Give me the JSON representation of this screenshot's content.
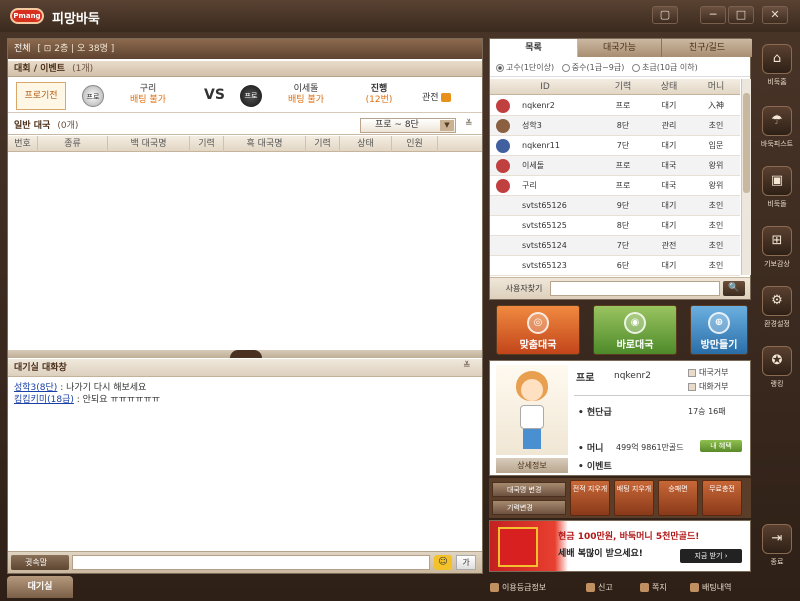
{
  "app": {
    "title": "피망바둑",
    "logo": "Pmang"
  },
  "window": {
    "buttons": [
      "▢",
      "─",
      "□",
      "✕"
    ]
  },
  "lobby": {
    "all_label": "전체",
    "all_count": "[ ⊡ 2층 | 오 38명 ]",
    "event_label": "대회 / 이벤트",
    "event_count": "(1개)",
    "pro_badge": "프로기전",
    "player1": {
      "stone": "프로",
      "name": "구리",
      "bet": "배팅 불가"
    },
    "vs": "VS",
    "player2": {
      "stone": "프로",
      "name": "이세돌",
      "bet": "배팅 불가"
    },
    "status": {
      "label": "진행",
      "move": "(12번)"
    },
    "watch": "관전",
    "general_label": "일반 대국",
    "general_count": "(0개)",
    "rank_filter": "프로 ~ 8단",
    "columns": [
      "번호",
      "종류",
      "백 대국명",
      "기력",
      "흑 대국명",
      "기력",
      "상태",
      "인원"
    ]
  },
  "chat": {
    "title": "대기실 대화창",
    "lines": [
      {
        "user": "성학3(8단)",
        "text": " : 나가기 다시 해보세요"
      },
      {
        "user": "킴킴키미(18급)",
        "text": " : 안되요 ㅠㅠㅠㅠㅠㅠ"
      }
    ],
    "whisper": "귓속말",
    "emoji": "☺",
    "font": "가"
  },
  "footer": {
    "waitroom_tab": "대기실",
    "links": [
      "이용등급정보",
      "신고",
      "쪽지",
      "배팅내역"
    ]
  },
  "userlist": {
    "tabs": [
      "목록",
      "대국가능",
      "친구/길드"
    ],
    "filters": [
      {
        "label": "고수(1단이상)",
        "on": true
      },
      {
        "label": "중수(1급~9급)",
        "on": false
      },
      {
        "label": "초급(10급 이하)",
        "on": false
      }
    ],
    "columns": [
      "ID",
      "기력",
      "상태",
      "머니"
    ],
    "rows": [
      {
        "id": "nqkenr2",
        "rank": "프로",
        "status": "대기",
        "money": "入神",
        "avatar": "#c04040"
      },
      {
        "id": "성학3",
        "rank": "8단",
        "status": "관리",
        "money": "초인",
        "avatar": "#8a6040"
      },
      {
        "id": "nqkenr11",
        "rank": "7단",
        "status": "대기",
        "money": "입문",
        "avatar": "#4060a0"
      },
      {
        "id": "이세돌",
        "rank": "프로",
        "status": "대국",
        "money": "왕위",
        "avatar": "#c04040"
      },
      {
        "id": "구리",
        "rank": "프로",
        "status": "대국",
        "money": "왕위",
        "avatar": "#c04040"
      },
      {
        "id": "svtst65126",
        "rank": "9단",
        "status": "대기",
        "money": "초인",
        "avatar": ""
      },
      {
        "id": "svtst65125",
        "rank": "8단",
        "status": "대기",
        "money": "초인",
        "avatar": ""
      },
      {
        "id": "svtst65124",
        "rank": "7단",
        "status": "관전",
        "money": "초인",
        "avatar": ""
      },
      {
        "id": "svtst65123",
        "rank": "6단",
        "status": "대기",
        "money": "초인",
        "avatar": ""
      }
    ],
    "search_label": "사용자찾기",
    "search_go": "🔍"
  },
  "actions": {
    "match": "맞춤대국",
    "quick": "바로대국",
    "room": "방만들기"
  },
  "profile": {
    "grade": "프로",
    "name": "nqkenr2",
    "reject_game": "대국거부",
    "reject_chat": "대화거부",
    "current_rank_label": "• 현단급",
    "record": "17승 16패",
    "money_label": "• 머니",
    "money_value": "499억 9861만골드",
    "money_btn": "내 혜택",
    "event_label": "• 이벤트",
    "detail_btn": "상세정보"
  },
  "tools": {
    "rename": "대국명 변경",
    "rank_change": "기력변경",
    "items": [
      "전적 지우개",
      "배팅 지우개",
      "승패면",
      "무료충전"
    ]
  },
  "banner": {
    "title": "현금 100만원, 바둑머니 5천만골드!",
    "sub": "세배 복많이 받으세요!",
    "btn": "지금 받기 ›"
  },
  "sidenav": [
    {
      "label": "비둑홈",
      "icon": "⌂"
    },
    {
      "label": "바둑피스트",
      "icon": "☂"
    },
    {
      "label": "비둑돌",
      "icon": "▣"
    },
    {
      "label": "기보감상",
      "icon": "⊞"
    },
    {
      "label": "환경설정",
      "icon": "⚙"
    },
    {
      "label": "랭킹",
      "icon": "✪"
    },
    {
      "label": "종료",
      "icon": "⇥"
    }
  ]
}
